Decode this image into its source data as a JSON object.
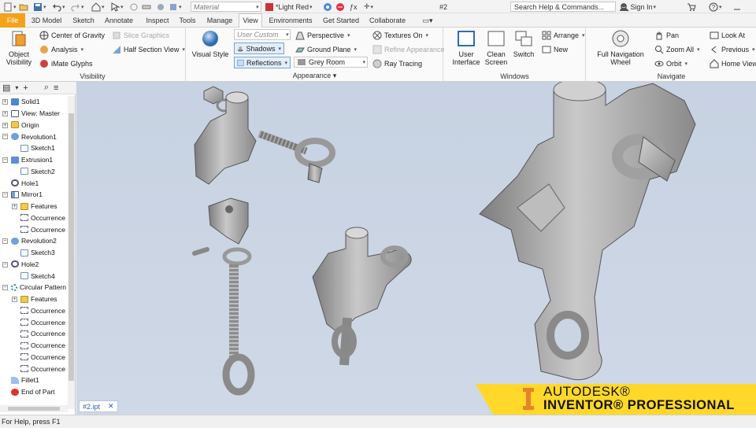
{
  "qat": {
    "material": "Material",
    "color": "*Light Red",
    "tab_title": "#2",
    "search_placeholder": "Search Help & Commands...",
    "sign_in": "Sign In"
  },
  "tabs": [
    "File",
    "3D Model",
    "Sketch",
    "Annotate",
    "Inspect",
    "Tools",
    "Manage",
    "View",
    "Environments",
    "Get Started",
    "Collaborate"
  ],
  "ribbon": {
    "visibility": {
      "title": "Visibility",
      "object_visibility": "Object Visibility",
      "center_of_gravity": "Center of Gravity",
      "slice_graphics": "Slice Graphics",
      "analysis": "Analysis",
      "half_section_view": "Half Section View",
      "imate_glyphs": "iMate Glyphs"
    },
    "appearance": {
      "title": "Appearance",
      "visual_style": "Visual Style",
      "user_custom": "User Custom",
      "shadows": "Shadows",
      "reflections": "Reflections",
      "perspective": "Perspective",
      "ground_plane": "Ground Plane",
      "grey_room": "Grey Room",
      "textures_on": "Textures On",
      "refine_appearance": "Refine Appearance",
      "ray_tracing": "Ray Tracing"
    },
    "windows": {
      "title": "Windows",
      "user_interface": "User Interface",
      "clean_screen": "Clean Screen",
      "switch": "Switch",
      "arrange": "Arrange",
      "new": "New"
    },
    "navigate": {
      "title": "Navigate",
      "full_navigation_wheel": "Full Navigation Wheel",
      "pan": "Pan",
      "zoom_all": "Zoom All",
      "orbit": "Orbit",
      "look_at": "Look At",
      "previous": "Previous",
      "home_view": "Home View"
    }
  },
  "browser": {
    "nodes": [
      {
        "label": "Solid1",
        "indent": 1,
        "expander": "+",
        "icon": "solid-icon"
      },
      {
        "label": "View: Master",
        "indent": 1,
        "expander": "+",
        "icon": "view-icon"
      },
      {
        "label": "Origin",
        "indent": 1,
        "expander": "+",
        "icon": "folder-icon"
      },
      {
        "label": "Revolution1",
        "indent": 1,
        "expander": "-",
        "icon": "revolution-icon"
      },
      {
        "label": "Sketch1",
        "indent": 2,
        "expander": "",
        "icon": "sketch-icon"
      },
      {
        "label": "Extrusion1",
        "indent": 1,
        "expander": "-",
        "icon": "extrusion-icon"
      },
      {
        "label": "Sketch2",
        "indent": 2,
        "expander": "",
        "icon": "sketch-icon"
      },
      {
        "label": "Hole1",
        "indent": 1,
        "expander": "",
        "icon": "hole-icon"
      },
      {
        "label": "Mirror1",
        "indent": 1,
        "expander": "-",
        "icon": "mirror-icon"
      },
      {
        "label": "Features",
        "indent": 2,
        "expander": "+",
        "icon": "folder-icon"
      },
      {
        "label": "Occurrence",
        "indent": 2,
        "expander": "",
        "icon": "occurrence-icon"
      },
      {
        "label": "Occurrence",
        "indent": 2,
        "expander": "",
        "icon": "occurrence-icon"
      },
      {
        "label": "Revolution2",
        "indent": 1,
        "expander": "-",
        "icon": "revolution-icon"
      },
      {
        "label": "Sketch3",
        "indent": 2,
        "expander": "",
        "icon": "sketch-icon"
      },
      {
        "label": "Hole2",
        "indent": 1,
        "expander": "-",
        "icon": "hole-icon"
      },
      {
        "label": "Sketch4",
        "indent": 2,
        "expander": "",
        "icon": "sketch-icon"
      },
      {
        "label": "Circular Pattern",
        "indent": 1,
        "expander": "-",
        "icon": "pattern-icon"
      },
      {
        "label": "Features",
        "indent": 2,
        "expander": "+",
        "icon": "folder-icon"
      },
      {
        "label": "Occurrence",
        "indent": 2,
        "expander": "",
        "icon": "occurrence-icon"
      },
      {
        "label": "Occurrence",
        "indent": 2,
        "expander": "",
        "icon": "occurrence-icon"
      },
      {
        "label": "Occurrence",
        "indent": 2,
        "expander": "",
        "icon": "occurrence-icon"
      },
      {
        "label": "Occurrence",
        "indent": 2,
        "expander": "",
        "icon": "occurrence-icon"
      },
      {
        "label": "Occurrence",
        "indent": 2,
        "expander": "",
        "icon": "occurrence-icon"
      },
      {
        "label": "Occurrence",
        "indent": 2,
        "expander": "",
        "icon": "occurrence-icon"
      },
      {
        "label": "Fillet1",
        "indent": 1,
        "expander": "",
        "icon": "fillet-icon"
      },
      {
        "label": "End of Part",
        "indent": 1,
        "expander": "",
        "icon": "end-of-part-icon"
      }
    ]
  },
  "document_tab": {
    "label": "#2.ipt",
    "close": "✕"
  },
  "brand": {
    "line1": "AUTODESK®",
    "line2": "INVENTOR® PROFESSIONAL"
  },
  "status": "For Help, press F1",
  "colors": {
    "file_tab": "#f4a21a",
    "brand_yellow": "#ffd82a",
    "viewport": "#cad4e3",
    "part": "#a9a9a9"
  }
}
